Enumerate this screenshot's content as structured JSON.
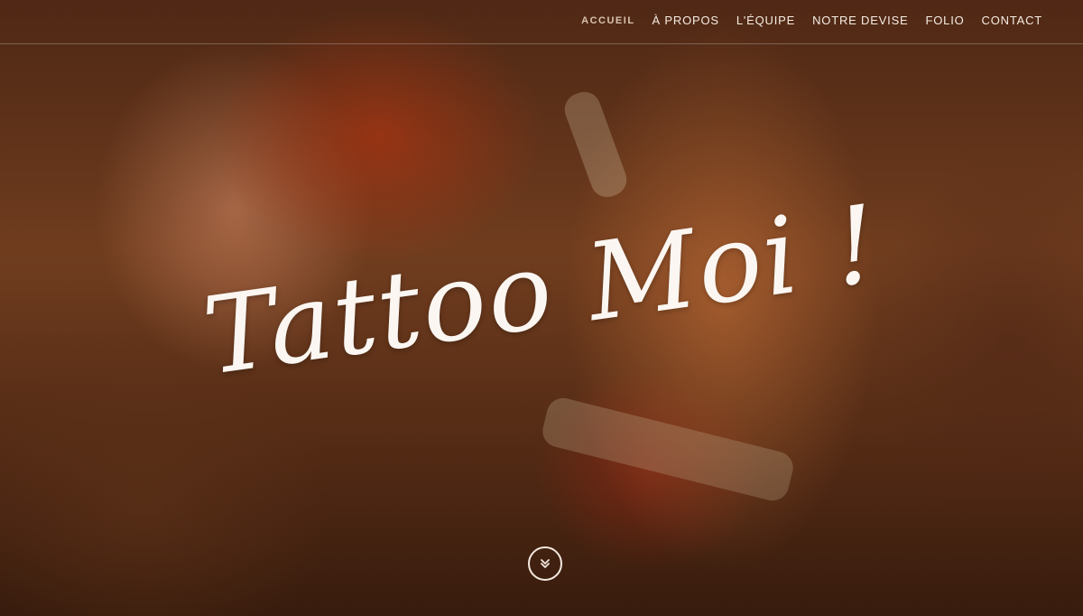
{
  "nav": {
    "items": [
      {
        "label": "ACCUEIL",
        "active": true
      },
      {
        "label": "À PROPOS",
        "active": false
      },
      {
        "label": "L'ÉQUIPE",
        "active": false
      },
      {
        "label": "NOTRE DEVISE",
        "active": false
      },
      {
        "label": "FOLIO",
        "active": false
      },
      {
        "label": "CONTACT",
        "active": false
      }
    ]
  },
  "hero": {
    "title": "Tattoo Moi !",
    "scroll_icon": "chevron-double-down-icon"
  },
  "colors": {
    "text": "#fbf6f1",
    "active_nav": "#d9c3b0"
  }
}
